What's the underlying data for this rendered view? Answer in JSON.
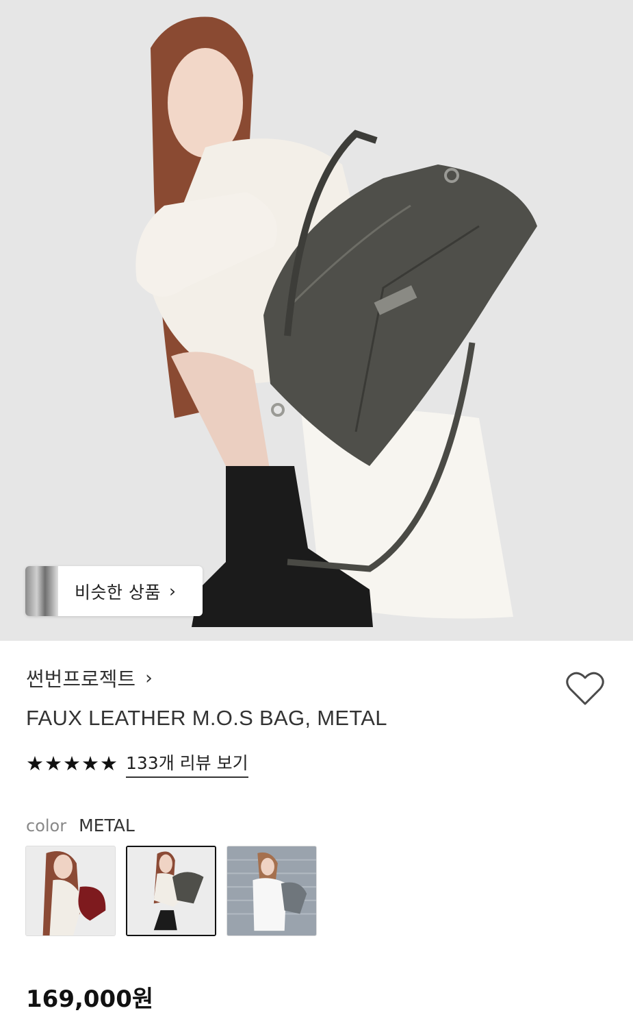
{
  "similar": {
    "label": "비슷한 상품"
  },
  "brand": {
    "name": "썬번프로젝트"
  },
  "product": {
    "title": "FAUX LEATHER M.O.S BAG, METAL",
    "price": "169,000원"
  },
  "rating": {
    "stars": 5,
    "review_link": "133개 리뷰 보기"
  },
  "color": {
    "key": "color",
    "value": "METAL",
    "options": [
      "BURGUNDY",
      "METAL",
      "GRAY"
    ],
    "selected_index": 1
  },
  "icons": {
    "chevron": "chevron-right-icon",
    "wish": "heart-outline-icon",
    "star": "star-filled-icon"
  }
}
